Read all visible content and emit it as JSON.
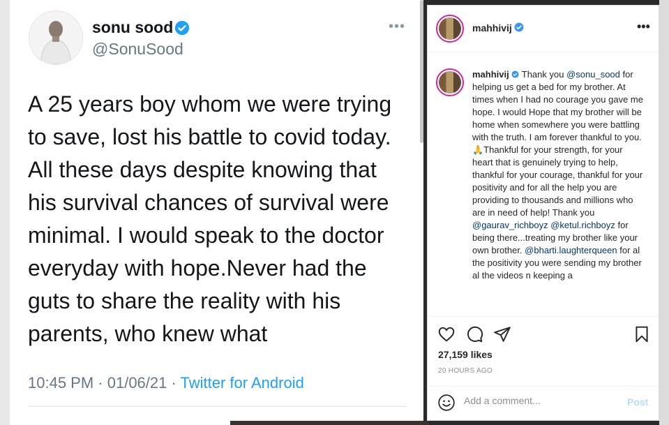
{
  "tweet": {
    "name": "sonu sood",
    "handle": "@SonuSood",
    "more": "•••",
    "text": "A 25 years boy whom we were trying to save,  lost his battle to covid today. All these days despite knowing that his survival chances of survival were minimal. I would  speak to the doctor everyday with hope.Never had the guts to share the reality with his parents, who knew what",
    "time": "10:45 PM",
    "sep1": " · ",
    "date": "01/06/21",
    "sep2": " · ",
    "source": "Twitter for Android",
    "verified_color": "#1da1f2"
  },
  "instagram": {
    "username": "mahhivij",
    "more": "•••",
    "caption_user": "mahhivij",
    "caption_parts": {
      "p1": " Thank you ",
      "m1": "@sonu_sood",
      "p2": " for helping us get a bed for my brother. At times when I had no courage you gave me hope. I would Hope that my brother will be home when somewhere you were battling with the truth. I am forever thankful to you.🙏Thankful for your strength, for your heart that is genuinely trying to help, thankful for your courage, thankful for your positivity and for all the help you are providing to thousands and millions who are in need of help! Thank you ",
      "m2": "@gaurav_richboyz",
      "p3": " ",
      "m3": "@ketul.richboyz",
      "p4": " for being there...treating my brother like your own brother. ",
      "m4": "@bharti.laughterqueen",
      "p5": " for al the positivity you were sending my brother al the videos n keeping a"
    },
    "likes": "27,159 likes",
    "time_ago": "20 HOURS AGO",
    "comment_placeholder": "Add a comment...",
    "post_label": "Post",
    "verified_color": "#3897f0"
  }
}
